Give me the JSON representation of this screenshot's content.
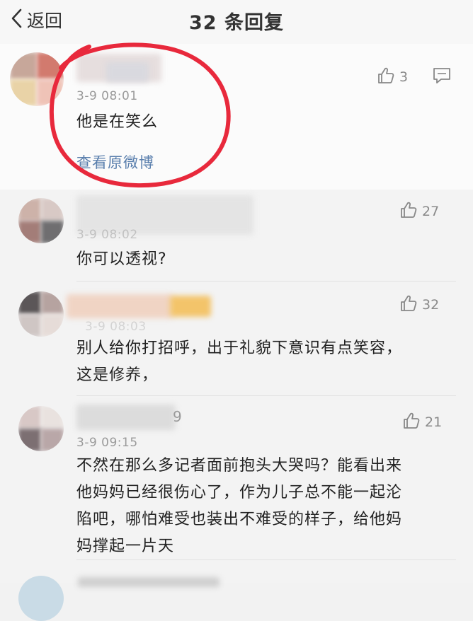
{
  "nav": {
    "back_label": "返回",
    "title": "32 条回复"
  },
  "main_comment": {
    "time": "3-9 08:01",
    "text": "他是在笑么",
    "link": "查看原微博",
    "likes": "3",
    "icons": {
      "like": "thumb-up-icon",
      "comment": "comment-icon"
    }
  },
  "replies": [
    {
      "time": "3-9 08:02",
      "text": "你可以透视?",
      "likes": "27"
    },
    {
      "time": "3-9 08:03",
      "text_lines": [
        "别人给你打招呼，出于礼貌下意识有点笑容，",
        "这是修养，"
      ],
      "likes": "32"
    },
    {
      "name_suffix": "9",
      "time": "3-9 09:15",
      "text_lines": [
        "不然在那么多记者面前抱头大哭吗？能看出来",
        "他妈妈已经很伤心了，作为儿子总不能一起沦",
        "陷吧，哪怕难受也装出不难受的样子，给他妈",
        "妈撑起一片天"
      ],
      "likes": "21"
    }
  ],
  "annotation": {
    "color": "#e8293c"
  }
}
